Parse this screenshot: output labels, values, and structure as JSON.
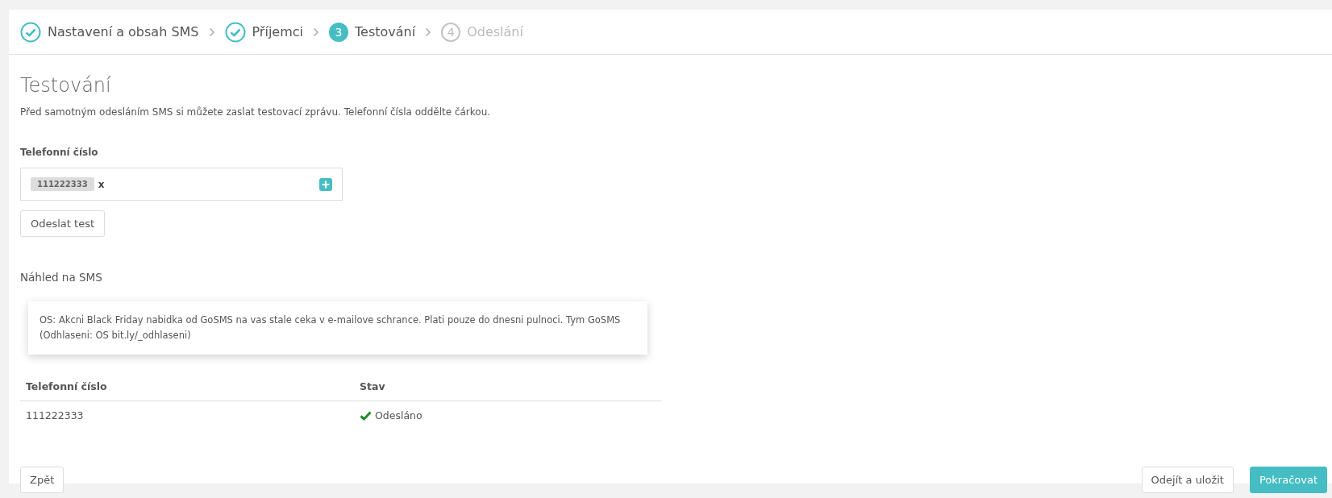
{
  "steps": [
    {
      "label": "Nastavení a obsah SMS",
      "kind": "done"
    },
    {
      "label": "Příjemci",
      "kind": "done"
    },
    {
      "number": "3",
      "label": "Testování",
      "kind": "active"
    },
    {
      "number": "4",
      "label": "Odeslání",
      "kind": "pending"
    }
  ],
  "heading": "Testování",
  "description": "Před samotným odesláním SMS si můžete zaslat testovací zprávu. Telefonní čísla oddělte čárkou.",
  "phone_field": {
    "label": "Telefonní číslo",
    "tags": [
      {
        "value": "111222333",
        "remove": "x"
      }
    ]
  },
  "send_test_button": "Odeslat test",
  "preview": {
    "title": "Náhled na SMS",
    "text": "OS: Akcni Black Friday nabidka od GoSMS na vas stale ceka v e-mailove schrance. Plati pouze do dnesni pulnoci. Tym GoSMS (Odhlaseni: OS bit.ly/_odhlaseni)"
  },
  "table": {
    "columns": [
      "Telefonní číslo",
      "Stav"
    ],
    "rows": [
      {
        "phone": "111222333",
        "status": "Odesláno",
        "kind": "sent"
      }
    ]
  },
  "footer": {
    "back": "Zpět",
    "save_exit": "Odejít a uložit",
    "continue": "Pokračovat"
  }
}
